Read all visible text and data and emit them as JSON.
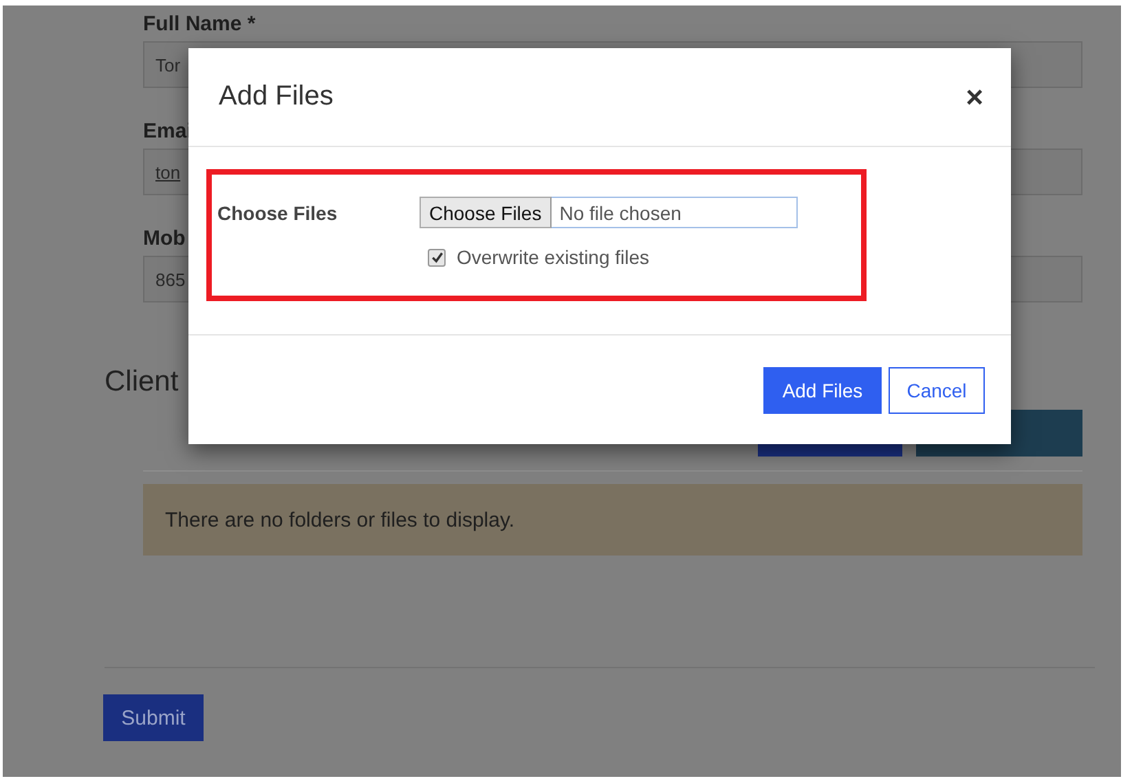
{
  "form": {
    "fields": [
      {
        "label": "Full Name *",
        "value": "Tor",
        "kind": "text"
      },
      {
        "label": "Emai",
        "value": "ton",
        "kind": "email"
      },
      {
        "label": "Mob",
        "value": "865",
        "kind": "text"
      }
    ],
    "section_title": "Client",
    "toolbar_buttons": [
      {
        "kind": "primary"
      },
      {
        "kind": "secondary"
      }
    ],
    "empty_message": "There are no folders or files to display.",
    "submit_button": "Submit"
  },
  "dialog": {
    "title": "Add Files",
    "close": "×",
    "field_label": "Choose Files",
    "file_button": "Choose Files",
    "file_status": "No file chosen",
    "overwrite": {
      "label": "Overwrite existing files",
      "checked": true
    },
    "buttons": [
      {
        "label": "Add Files",
        "kind": "primary"
      },
      {
        "label": "Cancel",
        "kind": "secondary"
      }
    ]
  }
}
